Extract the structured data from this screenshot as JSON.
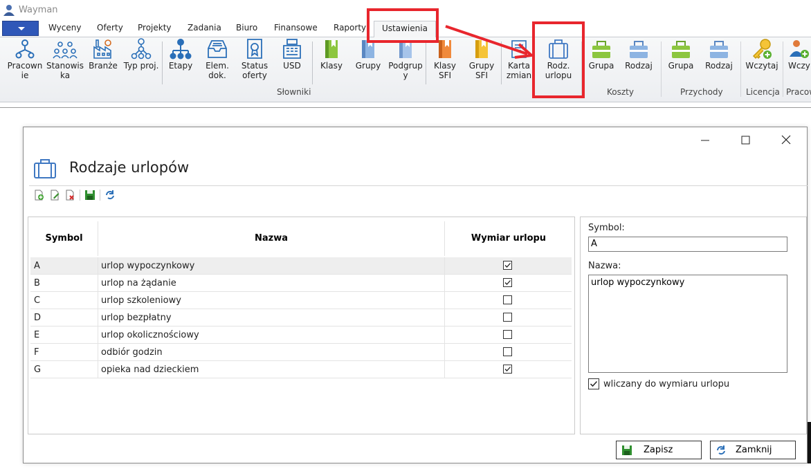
{
  "app": {
    "title": "Wayman"
  },
  "tabs": [
    {
      "label": "Wyceny"
    },
    {
      "label": "Oferty"
    },
    {
      "label": "Projekty"
    },
    {
      "label": "Zadania"
    },
    {
      "label": "Biuro"
    },
    {
      "label": "Finansowe"
    },
    {
      "label": "Raporty"
    },
    {
      "label": "Ustawienia",
      "active": true
    }
  ],
  "ribbon": {
    "slowniki": {
      "group_label": "Słowniki",
      "items": [
        {
          "l1": "Pracown",
          "l2": "ie"
        },
        {
          "l1": "Stanowis",
          "l2": "ka"
        },
        {
          "l1": "Branże",
          "l2": ""
        },
        {
          "l1": "Typ proj.",
          "l2": ""
        },
        {
          "l1": "Etapy",
          "l2": ""
        },
        {
          "l1": "Elem.",
          "l2": "dok."
        },
        {
          "l1": "Status",
          "l2": "oferty"
        },
        {
          "l1": "USD",
          "l2": ""
        },
        {
          "l1": "Klasy",
          "l2": ""
        },
        {
          "l1": "Grupy",
          "l2": ""
        },
        {
          "l1": "Podgrup",
          "l2": "y"
        },
        {
          "l1": "Klasy",
          "l2": "SFI"
        },
        {
          "l1": "Grupy",
          "l2": "SFI"
        },
        {
          "l1": "Karta",
          "l2": "zmian"
        },
        {
          "l1": "Rodz.",
          "l2": "urlopu"
        }
      ]
    },
    "koszty": {
      "group_label": "Koszty",
      "items": [
        {
          "l1": "Grupa"
        },
        {
          "l1": "Rodzaj"
        }
      ]
    },
    "przychody": {
      "group_label": "Przychody",
      "items": [
        {
          "l1": "Grupa"
        },
        {
          "l1": "Rodzaj"
        }
      ]
    },
    "licencja": {
      "group_label": "Licencja",
      "items": [
        {
          "l1": "Wczytaj"
        }
      ]
    },
    "pracownik": {
      "group_label": "Pracow",
      "items": [
        {
          "l1": "Wczy"
        }
      ]
    }
  },
  "dialog": {
    "title": "Rodzaje urlopów",
    "table": {
      "headers": {
        "symbol": "Symbol",
        "name": "Nazwa",
        "wymiar": "Wymiar urlopu"
      },
      "rows": [
        {
          "symbol": "A",
          "name": "urlop wypoczynkowy",
          "wymiar": true,
          "selected": true
        },
        {
          "symbol": "B",
          "name": "urlop na żądanie",
          "wymiar": true
        },
        {
          "symbol": "C",
          "name": "urlop szkoleniowy",
          "wymiar": false
        },
        {
          "symbol": "D",
          "name": "urlop bezpłatny",
          "wymiar": false
        },
        {
          "symbol": "E",
          "name": "urlop okolicznościowy",
          "wymiar": false
        },
        {
          "symbol": "F",
          "name": "odbiór godzin",
          "wymiar": false
        },
        {
          "symbol": "G",
          "name": "opieka nad dzieckiem",
          "wymiar": true
        }
      ]
    },
    "form": {
      "symbol_label": "Symbol:",
      "symbol_value": "A",
      "name_label": "Nazwa:",
      "name_value": "urlop wypoczynkowy",
      "wymiar_label": "wliczany do wymiaru urlopu",
      "wymiar_checked": true
    },
    "buttons": {
      "save": "Zapisz",
      "close": "Zamknij"
    }
  },
  "colors": {
    "annotation": "#e8262d",
    "app_menu": "#2f57b8"
  }
}
